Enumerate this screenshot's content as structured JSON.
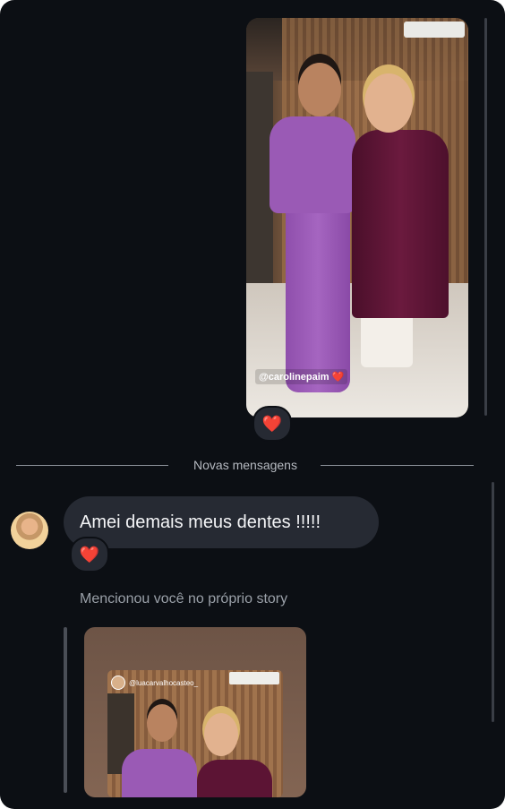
{
  "story_top": {
    "tag": "@carolinepaim",
    "tag_heart": "❤️",
    "reaction": "❤️"
  },
  "divider": {
    "label": "Novas mensagens"
  },
  "message": {
    "text": "Amei demais meus dentes !!!!!",
    "reaction": "❤️"
  },
  "mention": {
    "label": "Mencionou você no próprio story",
    "handle": "@luacarvalhocasteo_"
  },
  "colors": {
    "background": "#0c0f14",
    "bubble": "#262a33",
    "heart": "#ed2f4f"
  }
}
